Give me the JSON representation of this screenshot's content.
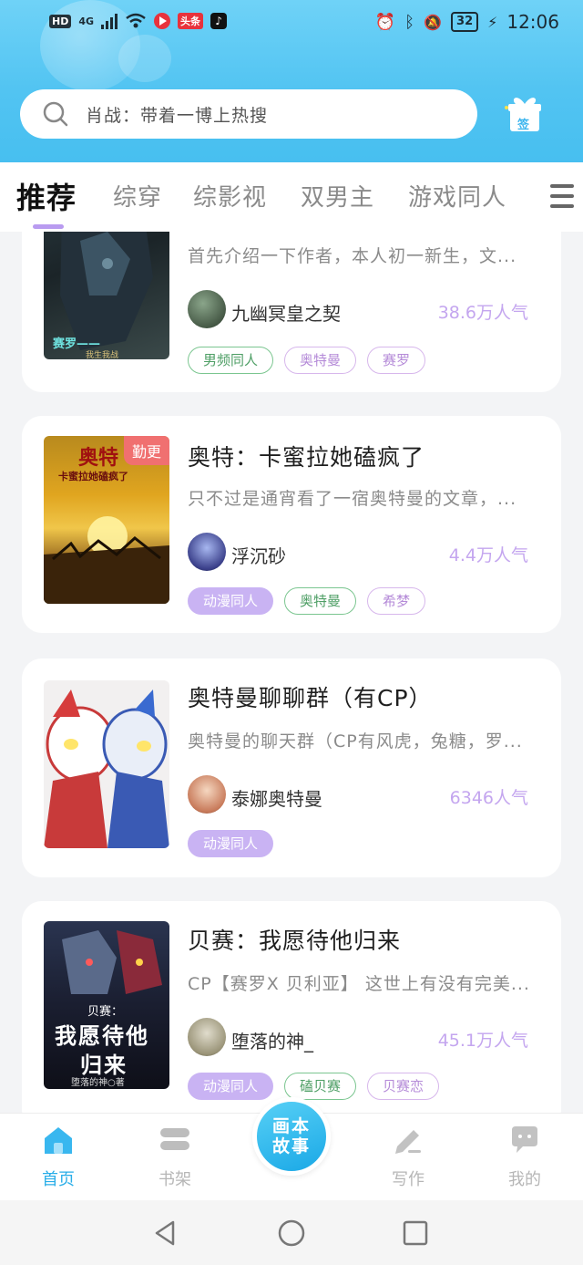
{
  "status_bar": {
    "left_chips": [
      "HD",
      "4G"
    ],
    "battery": "32",
    "time": "12:06"
  },
  "search": {
    "placeholder": "肖战：带着一博上热搜",
    "icon": "search-icon"
  },
  "gift_label": "签",
  "tabs": [
    {
      "label": "推荐",
      "active": true
    },
    {
      "label": "综穿",
      "active": false
    },
    {
      "label": "综影视",
      "active": false
    },
    {
      "label": "双男主",
      "active": false
    },
    {
      "label": "游戏同人",
      "active": false
    }
  ],
  "cards": [
    {
      "title": "",
      "desc": "首先介绍一下作者，本人初一新生，文...",
      "author": "九幽冥皇之契",
      "popularity": "38.6万人气",
      "cover_text": [
        "赛罗——",
        "我生我战"
      ],
      "badge": "",
      "tags": [
        {
          "label": "男频同人",
          "style": "green"
        },
        {
          "label": "奥特曼",
          "style": "pink"
        },
        {
          "label": "赛罗",
          "style": "pink"
        }
      ]
    },
    {
      "title": "奥特：卡蜜拉她磕疯了",
      "desc": "只不过是通宵看了一宿奥特曼的文章，...",
      "author": "浮沉砂",
      "popularity": "4.4万人气",
      "cover_text": [
        "奥特",
        "卡蜜拉她磕疯了"
      ],
      "badge": "勤更",
      "tags": [
        {
          "label": "动漫同人",
          "style": "purple"
        },
        {
          "label": "奥特曼",
          "style": "green"
        },
        {
          "label": "希梦",
          "style": "pink"
        }
      ]
    },
    {
      "title": "奥特曼聊聊群（有CP）",
      "desc": "奥特曼的聊天群（CP有风虎，兔糖，罗...",
      "author": "泰娜奥特曼",
      "popularity": "6346人气",
      "cover_text": [],
      "badge": "",
      "tags": [
        {
          "label": "动漫同人",
          "style": "purple"
        }
      ]
    },
    {
      "title": "贝赛：我愿待他归来",
      "desc": "CP【赛罗X 贝利亚】 这世上有没有完美...",
      "author": "堕落的神_",
      "popularity": "45.1万人气",
      "cover_text": [
        "贝赛：",
        "我愿待他",
        "归来",
        "堕落的神○著"
      ],
      "badge": "",
      "tags": [
        {
          "label": "动漫同人",
          "style": "purple"
        },
        {
          "label": "磕贝赛",
          "style": "green"
        },
        {
          "label": "贝赛恋",
          "style": "pink"
        }
      ]
    }
  ],
  "bottom_nav": {
    "home": "首页",
    "shelf": "书架",
    "fab": "画本故事",
    "write": "写作",
    "mine": "我的"
  },
  "colors": {
    "header": "#52c4f2",
    "accent_purple": "#c9b3f3",
    "popularity": "#c4a6ef",
    "active_nav": "#2aaee8"
  }
}
